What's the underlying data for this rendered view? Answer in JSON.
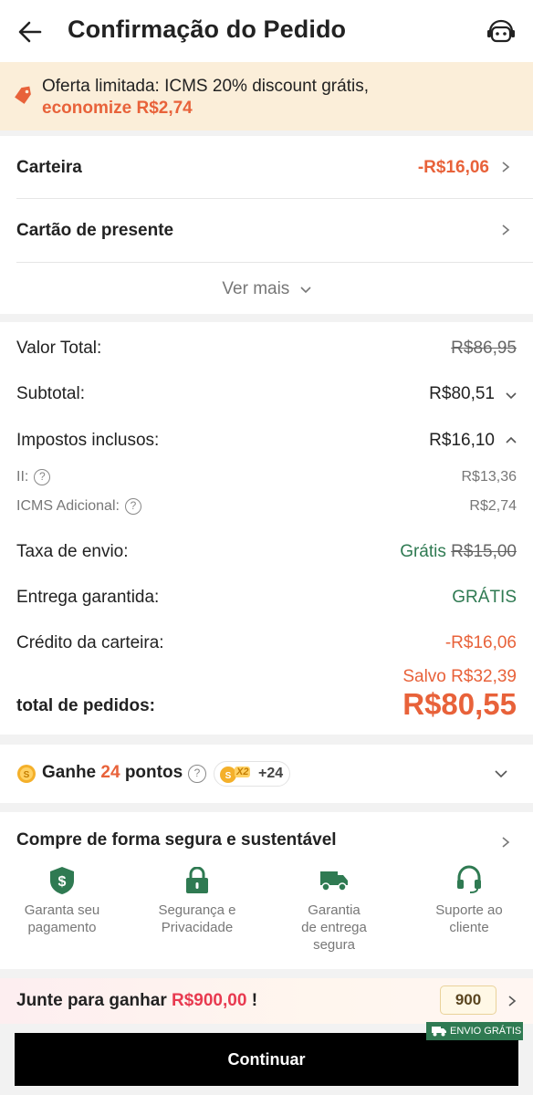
{
  "header": {
    "title": "Confirmação do Pedido",
    "back_icon": "arrow-left-icon",
    "support_icon": "robot-support-icon"
  },
  "promo": {
    "text": "Oferta limitada: ICMS 20% discount grátis,",
    "save_text": "economize R$2,74"
  },
  "payment_options": {
    "wallet_label": "Carteira",
    "wallet_value": "-R$16,06",
    "gift_card_label": "Cartão de presente",
    "see_more_label": "Ver mais"
  },
  "summary": {
    "total_value_label": "Valor Total:",
    "total_value": "R$86,95",
    "subtotal_label": "Subtotal:",
    "subtotal_value": "R$80,51",
    "taxes_label": "Impostos inclusos:",
    "taxes_value": "R$16,10",
    "ii_label": "II:",
    "ii_value": "R$13,36",
    "icms_label": "ICMS Adicional:",
    "icms_value": "R$2,74",
    "shipping_label": "Taxa de envio:",
    "shipping_free": "Grátis",
    "shipping_original": "R$15,00",
    "guaranteed_label": "Entrega garantida:",
    "guaranteed_value": "GRÁTIS",
    "wallet_credit_label": "Crédito da carteira:",
    "wallet_credit_value": "-R$16,06",
    "saved_text": "Salvo R$32,39",
    "order_total_label": "total de pedidos:",
    "order_total_value": "R$80,55"
  },
  "points": {
    "prefix": "Ganhe",
    "count": "24",
    "suffix": "pontos",
    "badge_multiplier": "X2",
    "badge_bonus": "+24"
  },
  "secure": {
    "title": "Compre de forma segura e sustentável",
    "features": [
      {
        "icon": "shield-dollar-icon",
        "label_1": "Garanta seu",
        "label_2": "pagamento",
        "label_3": ""
      },
      {
        "icon": "lock-icon",
        "label_1": "Segurança e",
        "label_2": "Privacidade",
        "label_3": ""
      },
      {
        "icon": "delivery-truck-icon",
        "label_1": "Garantia",
        "label_2": "de entrega",
        "label_3": "segura"
      },
      {
        "icon": "headset-icon",
        "label_1": "Suporte ao",
        "label_2": "cliente",
        "label_3": ""
      }
    ]
  },
  "join": {
    "prefix": "Junte para ganhar",
    "amount": "R$900,00",
    "suffix": "!",
    "coupon": "900"
  },
  "footer": {
    "ribbon": "ENVIO GRÁTIS",
    "continue_label": "Continuar"
  },
  "colors": {
    "accent_orange": "#e8623a",
    "green": "#2f7a52",
    "promo_bg": "#fbeed9",
    "cta_bg": "#000000"
  }
}
